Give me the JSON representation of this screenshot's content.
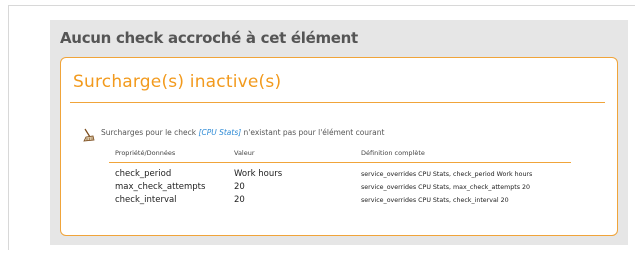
{
  "panel": {
    "title": "Aucun check accroché à cet élément"
  },
  "overrides_box": {
    "title": "Surcharge(s) inactive(s)",
    "info_prefix": "Surcharges pour le check ",
    "check_name": "[CPU Stats]",
    "info_suffix": " n'existant pas pour l'élément courant",
    "icon": "broom-icon",
    "columns": [
      "Propriété/Données",
      "Valeur",
      "Définition complète"
    ],
    "rows": [
      {
        "property": "check_period",
        "value": "Work hours",
        "definition": "service_overrides  CPU Stats, check_period Work hours"
      },
      {
        "property": "max_check_attempts",
        "value": "20",
        "definition": "service_overrides  CPU Stats, max_check_attempts 20"
      },
      {
        "property": "check_interval",
        "value": "20",
        "definition": "service_overrides  CPU Stats, check_interval 20"
      }
    ]
  },
  "colors": {
    "accent": "#f29a1d",
    "link": "#2e8bd6",
    "panel_bg": "#e6e6e6"
  }
}
